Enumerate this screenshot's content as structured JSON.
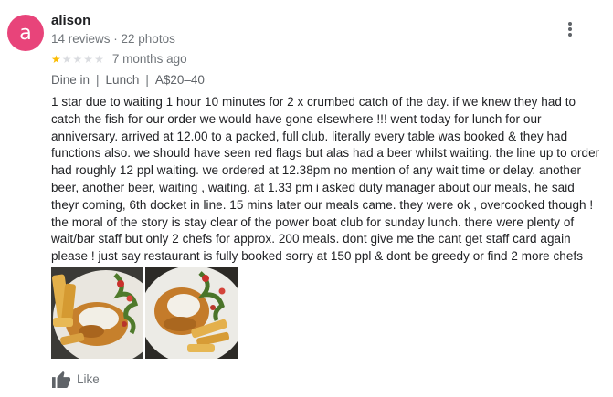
{
  "reviewer": {
    "avatar_letter": "a",
    "avatar_color": "#e8447a",
    "name": "alison",
    "stats": "14 reviews · 22 photos"
  },
  "rating": {
    "value": 1,
    "max": 5,
    "filled_color": "#fbbc04",
    "empty_color": "#dadce0"
  },
  "time_ago": "7 months ago",
  "tags": [
    "Dine in",
    "Lunch",
    "A$20–40"
  ],
  "review_text": "1 star due to waiting 1 hour 10 minutes for 2 x crumbed catch of the day. if we knew they had to catch the fish for our order we would have gone elsewhere !!! went today for lunch for  our anniversary. arrived at 12.00 to a packed, full club. literally every table was booked & they had functions also. we should have seen red flags but alas had a beer whilst waiting. the line up to order had roughly 12 ppl waiting. we ordered at 12.38pm no mention of any wait time or delay. another beer, another beer, waiting , waiting. at 1.33 pm i asked duty manager about our meals, he said theyr coming, 6th  docket in line. 15 mins later our meals came. they were ok , overcooked though ! the moral of the story is stay clear of the power boat club for sunday lunch. there were plenty of wait/bar staff but only 2 chefs for approx. 200 meals. dont give me the cant get staff card again please ! just say restaurant is fully booked sorry at 150 ppl & dont be greedy or find 2 more chefs",
  "photos": [
    {
      "icon": "food-photo"
    },
    {
      "icon": "food-photo"
    }
  ],
  "actions": {
    "like_label": "Like",
    "like_icon": "thumbs-up-icon",
    "more_icon": "more-vert-icon"
  }
}
